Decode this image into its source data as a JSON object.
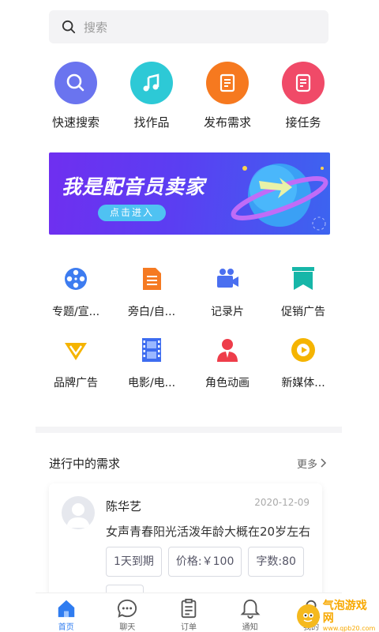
{
  "search": {
    "placeholder": "搜索"
  },
  "quick_actions": [
    {
      "label": "快速搜索",
      "icon": "search-icon",
      "color": "#6a74ef"
    },
    {
      "label": "找作品",
      "icon": "music-note-icon",
      "color": "#2dc9d6"
    },
    {
      "label": "发布需求",
      "icon": "document-icon",
      "color": "#f6791f"
    },
    {
      "label": "接任务",
      "icon": "task-list-icon",
      "color": "#f04a68"
    }
  ],
  "banner": {
    "title": "我是配音员卖家",
    "button": "点击进入"
  },
  "categories": [
    {
      "label": "专题/宣...",
      "icon": "film-reel-icon",
      "color": "#3d7cf0"
    },
    {
      "label": "旁白/自...",
      "icon": "document-lines-icon",
      "color": "#f57a22"
    },
    {
      "label": "记录片",
      "icon": "video-camera-icon",
      "color": "#4a6ff0"
    },
    {
      "label": "促销广告",
      "icon": "bookmark-icon",
      "color": "#16b6a8"
    },
    {
      "label": "品牌广告",
      "icon": "diamond-v-icon",
      "color": "#f5b400"
    },
    {
      "label": "电影/电...",
      "icon": "film-strip-icon",
      "color": "#3d6cf0"
    },
    {
      "label": "角色动画",
      "icon": "character-icon",
      "color": "#ee3d4a"
    },
    {
      "label": "新媒体...",
      "icon": "play-icon",
      "color": "#f5b400"
    }
  ],
  "section": {
    "title": "进行中的需求",
    "more": "更多"
  },
  "demand": {
    "name": "陈华艺",
    "date": "2020-12-09",
    "description": "女声青春阳光活泼年龄大概在20岁左右",
    "tags": [
      "1天到期",
      "价格:￥100",
      "字数:80"
    ]
  },
  "tabs": [
    {
      "label": "首页",
      "icon": "home-icon",
      "active": true
    },
    {
      "label": "聊天",
      "icon": "chat-icon",
      "active": false
    },
    {
      "label": "订单",
      "icon": "order-icon",
      "active": false
    },
    {
      "label": "通知",
      "icon": "bell-icon",
      "active": false
    },
    {
      "label": "我的",
      "icon": "profile-icon",
      "active": false
    }
  ],
  "watermark": {
    "name": "气泡游戏网",
    "sub": "www.qpb20.com"
  },
  "colors": {
    "accent": "#2f7cf0",
    "tab_inactive": "#666666"
  }
}
